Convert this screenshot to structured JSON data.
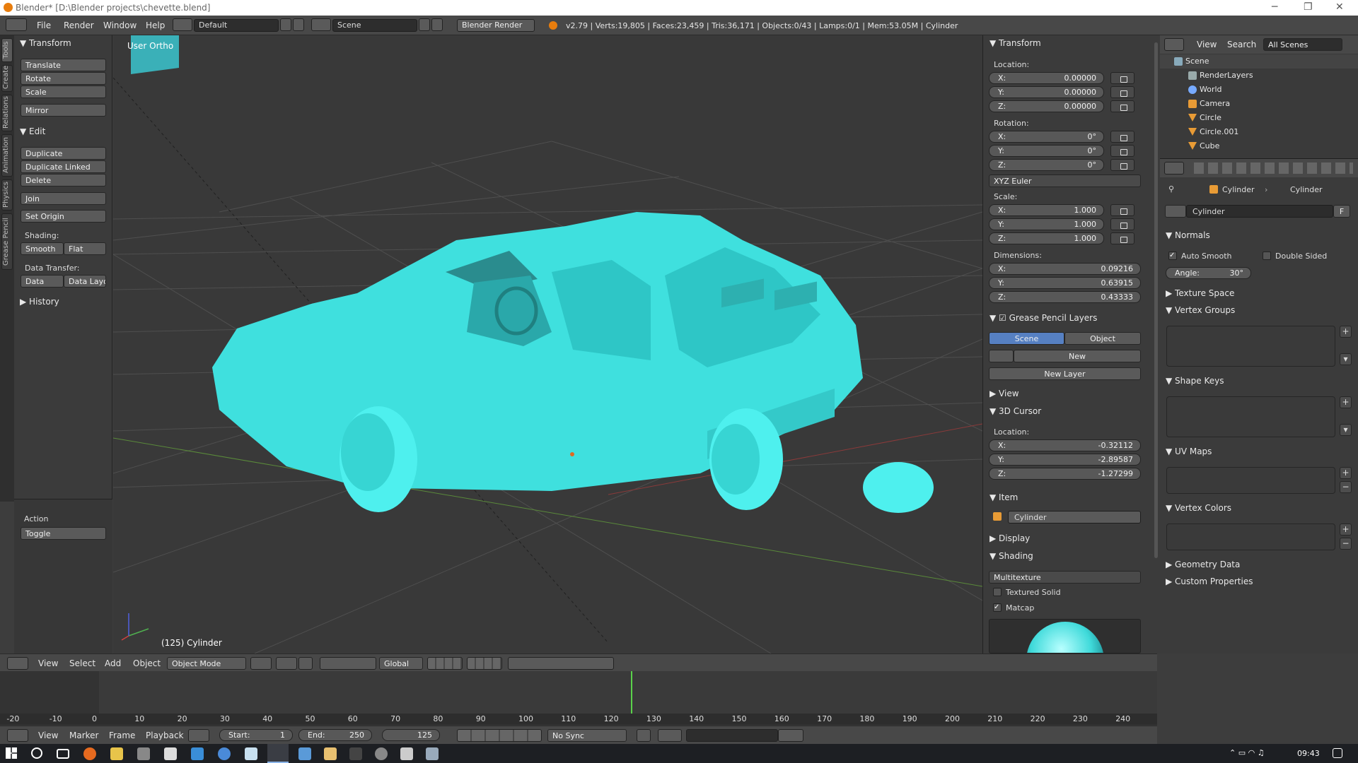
{
  "window": {
    "title": "Blender* [D:\\Blender projects\\chevette.blend]",
    "controls": {
      "minimize": "─",
      "maximize": "❐",
      "close": "✕"
    }
  },
  "infobar": {
    "menus": [
      "File",
      "Render",
      "Window",
      "Help"
    ],
    "screen_layout": "Default",
    "scene": "Scene",
    "render_engine": "Blender Render",
    "stats": "v2.79 | Verts:19,805 | Faces:23,459 | Tris:36,171 | Objects:0/43 | Lamps:0/1 | Mem:53.05M | Cylinder"
  },
  "tool_tabs": [
    "Tools",
    "Create",
    "Relations",
    "Animation",
    "Physics",
    "Grease Pencil"
  ],
  "toolshelf": {
    "transform": {
      "title": "Transform",
      "buttons": [
        "Translate",
        "Rotate",
        "Scale",
        "Mirror"
      ]
    },
    "edit": {
      "title": "Edit",
      "buttons": [
        "Duplicate",
        "Duplicate Linked",
        "Delete",
        "Join"
      ],
      "set_origin": "Set Origin",
      "shading_label": "Shading:",
      "smooth": "Smooth",
      "flat": "Flat",
      "data_transfer_label": "Data Transfer:",
      "data": "Data",
      "data_layout": "Data Layo"
    },
    "history": "History",
    "operator": {
      "label": "Action",
      "value": "Toggle"
    }
  },
  "viewport": {
    "view_name": "User Ortho",
    "object_label": "(125) Cylinder",
    "colors": {
      "background": "#393939",
      "model": "#3ee3e0",
      "grid": "#505050"
    }
  },
  "properties_panel": {
    "transform": {
      "title": "Transform",
      "location_label": "Location:",
      "location": [
        {
          "axis": "X:",
          "value": "0.00000"
        },
        {
          "axis": "Y:",
          "value": "0.00000"
        },
        {
          "axis": "Z:",
          "value": "0.00000"
        }
      ],
      "rotation_label": "Rotation:",
      "rotation": [
        {
          "axis": "X:",
          "value": "0°"
        },
        {
          "axis": "Y:",
          "value": "0°"
        },
        {
          "axis": "Z:",
          "value": "0°"
        }
      ],
      "rotation_mode": "XYZ Euler",
      "scale_label": "Scale:",
      "scale": [
        {
          "axis": "X:",
          "value": "1.000"
        },
        {
          "axis": "Y:",
          "value": "1.000"
        },
        {
          "axis": "Z:",
          "value": "1.000"
        }
      ],
      "dimensions_label": "Dimensions:",
      "dimensions": [
        {
          "axis": "X:",
          "value": "0.09216"
        },
        {
          "axis": "Y:",
          "value": "0.63915"
        },
        {
          "axis": "Z:",
          "value": "0.43333"
        }
      ]
    },
    "grease_pencil": {
      "title": "Grease Pencil Layers",
      "scene_tab": "Scene",
      "object_tab": "Object",
      "new": "New",
      "new_layer": "New Layer"
    },
    "view": "View",
    "cursor": {
      "title": "3D Cursor",
      "location_label": "Location:",
      "location": [
        {
          "axis": "X:",
          "value": "-0.32112"
        },
        {
          "axis": "Y:",
          "value": "-2.89587"
        },
        {
          "axis": "Z:",
          "value": "-1.27299"
        }
      ]
    },
    "item": {
      "title": "Item",
      "name": "Cylinder"
    },
    "display": "Display",
    "shading": {
      "title": "Shading",
      "mode": "Multitexture",
      "textured_solid": "Textured Solid",
      "matcap": "Matcap"
    }
  },
  "outliner": {
    "menus": [
      "View",
      "Search"
    ],
    "filter": "All Scenes",
    "items": [
      {
        "name": "Scene"
      },
      {
        "name": "RenderLayers"
      },
      {
        "name": "World"
      },
      {
        "name": "Camera"
      },
      {
        "name": "Circle"
      },
      {
        "name": "Circle.001"
      },
      {
        "name": "Cube"
      }
    ]
  },
  "mesh_props": {
    "breadcrumb": [
      "Cylinder",
      "Cylinder"
    ],
    "mesh_name": "Cylinder",
    "fake_user": "F",
    "normals": {
      "title": "Normals",
      "auto_smooth": "Auto Smooth",
      "double_sided": "Double Sided",
      "angle": "Angle:",
      "angle_value": "30°"
    },
    "sections": [
      "Texture Space",
      "Vertex Groups",
      "Shape Keys",
      "UV Maps",
      "Vertex Colors",
      "Geometry Data",
      "Custom Properties"
    ]
  },
  "view_header": {
    "menus": [
      "View",
      "Select",
      "Add",
      "Object"
    ],
    "mode": "Object Mode",
    "orientation": "Global"
  },
  "timeline": {
    "ticks": [
      "-20",
      "-10",
      "0",
      "10",
      "20",
      "30",
      "40",
      "50",
      "60",
      "70",
      "80",
      "90",
      "100",
      "110",
      "120",
      "130",
      "140",
      "150",
      "160",
      "170",
      "180",
      "190",
      "200",
      "210",
      "220",
      "230",
      "240"
    ],
    "current_frame": "125",
    "menus": [
      "View",
      "Marker",
      "Frame",
      "Playback"
    ],
    "start": "Start:",
    "start_value": "1",
    "end": "End:",
    "end_value": "250",
    "sync": "No Sync"
  },
  "taskbar": {
    "clock": "09:43"
  }
}
